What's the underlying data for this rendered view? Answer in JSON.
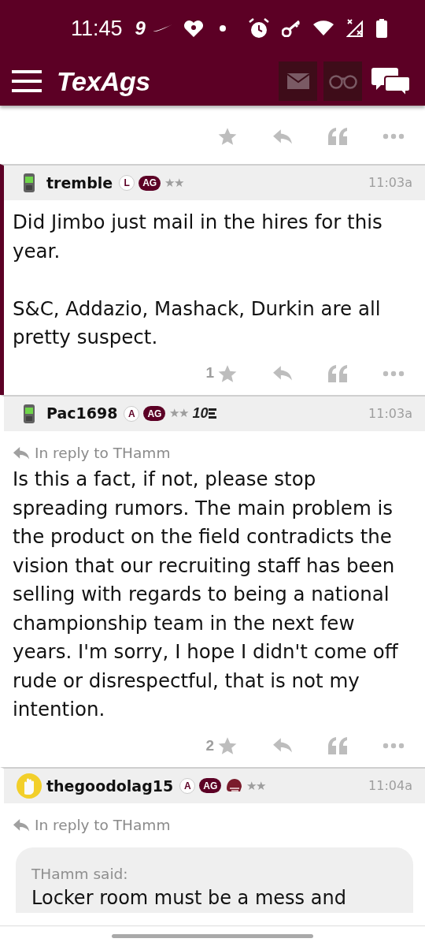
{
  "status_bar": {
    "time": "11:45",
    "app_number": "9"
  },
  "header": {
    "logo": "TexAgs",
    "buttons": [
      {
        "kind": "mail",
        "disabled": true
      },
      {
        "kind": "binoculars",
        "disabled": true
      },
      {
        "kind": "chat",
        "disabled": false
      }
    ]
  },
  "posts": [
    {
      "avatar": {
        "kind": "phone"
      },
      "username": "tremble",
      "badges": [
        {
          "kind": "circle",
          "text": "L"
        },
        {
          "kind": "pill",
          "text": "AG"
        },
        {
          "kind": "stars",
          "text": "★★"
        }
      ],
      "time": "11:03a",
      "highlighted": true,
      "body": "Did Jimbo just mail in the hires for this year.\n\nS&C, Addazio, Mashack, Durkin are all pretty suspect.",
      "likes": "1"
    },
    {
      "avatar": {
        "kind": "phone"
      },
      "username": "Pac1698",
      "badges": [
        {
          "kind": "circle",
          "text": "A"
        },
        {
          "kind": "pill",
          "text": "AG"
        },
        {
          "kind": "stars",
          "text": "★★"
        },
        {
          "kind": "ten",
          "text": "10"
        }
      ],
      "time": "11:03a",
      "highlighted": false,
      "reply_to": "In reply to THamm",
      "body": "Is this a fact, if not, please stop spreading rumors. The main problem is the product on the field contradicts the vision that our recruiting staff has been selling with regards to being a national championship team in the next few years. I'm sorry, I hope I didn't come off rude or disrespectful, that is not my intention.",
      "likes": "2"
    },
    {
      "avatar": {
        "kind": "hand"
      },
      "username": "thegoodolag15",
      "badges": [
        {
          "kind": "circle",
          "text": "A"
        },
        {
          "kind": "pill",
          "text": "AG"
        },
        {
          "kind": "helmet"
        },
        {
          "kind": "stars",
          "text": "★★"
        }
      ],
      "time": "11:04a",
      "highlighted": false,
      "reply_to": "In reply to THamm",
      "quote": {
        "author": "THamm said:",
        "text": "Locker room must be a mess and"
      }
    }
  ]
}
